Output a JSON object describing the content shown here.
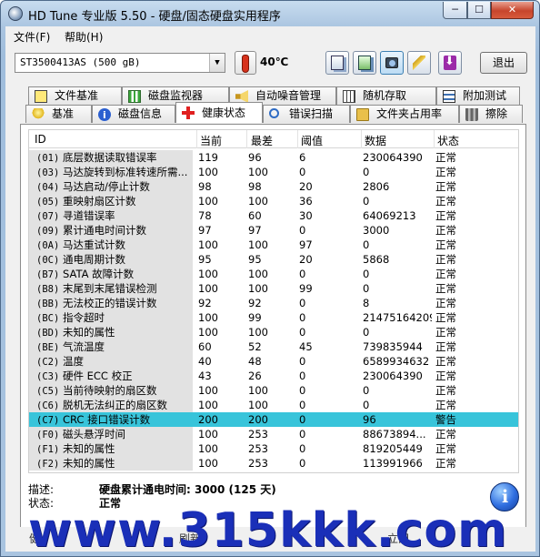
{
  "window": {
    "title": "HD Tune 专业版 5.50 - 硬盘/固态硬盘实用程序",
    "min_glyph": "─",
    "max_glyph": "☐",
    "close_glyph": "✕"
  },
  "menu": {
    "file": "文件(F)",
    "help": "帮助(H)"
  },
  "toolbar": {
    "drive": "ST3500413AS (500 gB)",
    "temperature": "40℃",
    "exit_label": "退出"
  },
  "tabs_top": [
    "文件基准",
    "磁盘监视器",
    "自动噪音管理",
    "随机存取",
    "附加测试"
  ],
  "tabs_bottom": [
    "基准",
    "磁盘信息",
    "健康状态",
    "错误扫描",
    "文件夹占用率",
    "擦除"
  ],
  "grid": {
    "headers": [
      "ID",
      "当前",
      "最差",
      "阈值",
      "数据",
      "状态"
    ],
    "rows": [
      {
        "code": "(01)",
        "name": "底层数据读取错误率",
        "cur": "119",
        "worst": "96",
        "thr": "6",
        "data": "230064390",
        "status": "正常"
      },
      {
        "code": "(03)",
        "name": "马达旋转到标准转速所需...",
        "cur": "100",
        "worst": "100",
        "thr": "0",
        "data": "0",
        "status": "正常"
      },
      {
        "code": "(04)",
        "name": "马达启动/停止计数",
        "cur": "98",
        "worst": "98",
        "thr": "20",
        "data": "2806",
        "status": "正常"
      },
      {
        "code": "(05)",
        "name": "重映射扇区计数",
        "cur": "100",
        "worst": "100",
        "thr": "36",
        "data": "0",
        "status": "正常"
      },
      {
        "code": "(07)",
        "name": "寻道错误率",
        "cur": "78",
        "worst": "60",
        "thr": "30",
        "data": "64069213",
        "status": "正常"
      },
      {
        "code": "(09)",
        "name": "累计通电时间计数",
        "cur": "97",
        "worst": "97",
        "thr": "0",
        "data": "3000",
        "status": "正常"
      },
      {
        "code": "(0A)",
        "name": "马达重试计数",
        "cur": "100",
        "worst": "100",
        "thr": "97",
        "data": "0",
        "status": "正常"
      },
      {
        "code": "(0C)",
        "name": "通电周期计数",
        "cur": "95",
        "worst": "95",
        "thr": "20",
        "data": "5868",
        "status": "正常"
      },
      {
        "code": "(B7)",
        "name": "SATA 故障计数",
        "cur": "100",
        "worst": "100",
        "thr": "0",
        "data": "0",
        "status": "正常"
      },
      {
        "code": "(B8)",
        "name": "末尾到末尾错误检测",
        "cur": "100",
        "worst": "100",
        "thr": "99",
        "data": "0",
        "status": "正常"
      },
      {
        "code": "(BB)",
        "name": "无法校正的错误计数",
        "cur": "92",
        "worst": "92",
        "thr": "0",
        "data": "8",
        "status": "正常"
      },
      {
        "code": "(BC)",
        "name": "指令超时",
        "cur": "100",
        "worst": "99",
        "thr": "0",
        "data": "21475164209",
        "status": "正常"
      },
      {
        "code": "(BD)",
        "name": "未知的属性",
        "cur": "100",
        "worst": "100",
        "thr": "0",
        "data": "0",
        "status": "正常"
      },
      {
        "code": "(BE)",
        "name": "气流温度",
        "cur": "60",
        "worst": "52",
        "thr": "45",
        "data": "739835944",
        "status": "正常"
      },
      {
        "code": "(C2)",
        "name": "温度",
        "cur": "40",
        "worst": "48",
        "thr": "0",
        "data": "6589934632",
        "status": "正常"
      },
      {
        "code": "(C3)",
        "name": "硬件 ECC 校正",
        "cur": "43",
        "worst": "26",
        "thr": "0",
        "data": "230064390",
        "status": "正常"
      },
      {
        "code": "(C5)",
        "name": "当前待映射的扇区数",
        "cur": "100",
        "worst": "100",
        "thr": "0",
        "data": "0",
        "status": "正常"
      },
      {
        "code": "(C6)",
        "name": "脱机无法纠正的扇区数",
        "cur": "100",
        "worst": "100",
        "thr": "0",
        "data": "0",
        "status": "正常"
      },
      {
        "code": "(C7)",
        "name": "CRC 接口错误计数",
        "cur": "200",
        "worst": "200",
        "thr": "0",
        "data": "96",
        "status": "警告"
      },
      {
        "code": "(F0)",
        "name": "磁头悬浮时间",
        "cur": "100",
        "worst": "253",
        "thr": "0",
        "data": "88673894...",
        "status": "正常"
      },
      {
        "code": "(F1)",
        "name": "未知的属性",
        "cur": "100",
        "worst": "253",
        "thr": "0",
        "data": "819205449",
        "status": "正常"
      },
      {
        "code": "(F2)",
        "name": "未知的属性",
        "cur": "100",
        "worst": "253",
        "thr": "0",
        "data": "113991966",
        "status": "正常"
      }
    ]
  },
  "description": {
    "desc_label": "描述:",
    "desc_value": "硬盘累计通电时间: 3000 (125 天)",
    "status_label": "状态:",
    "status_value": "正常"
  },
  "bottom": {
    "left": "健",
    "mid": "刷新",
    "right": "立即"
  },
  "watermark": "www.315kkk.com",
  "colors": {
    "highlight_row": "#38c4da",
    "watermark": "#1a2fb8"
  }
}
